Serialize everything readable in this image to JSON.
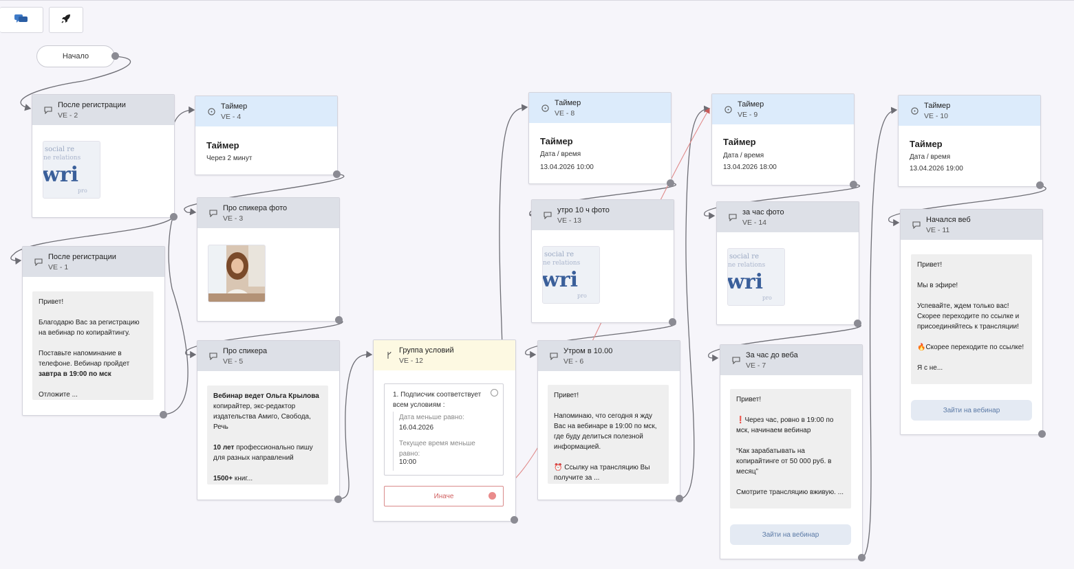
{
  "toolbar": {
    "chat_button_icon": "chat-bubbles-icon",
    "launch_button_icon": "rocket-icon"
  },
  "start_node": {
    "label": "Начало"
  },
  "colors": {
    "message_header": "#dde0e7",
    "timer_header": "#dcebfb",
    "condition_header": "#fdf9e2",
    "connector": "#6d6d74",
    "else_connector": "#e08a8a",
    "button_text": "#5b7aa6"
  },
  "nodes": {
    "ve2": {
      "title": "После регистрации",
      "id": "VE - 2",
      "icon": "chat-bubble-icon",
      "image": "writing-text-thumbnail"
    },
    "ve4": {
      "title": "Таймер",
      "id": "VE - 4",
      "icon": "clock-icon",
      "heading": "Таймер",
      "detail": "Через 2 минут"
    },
    "ve3": {
      "title": "Про спикера фото",
      "id": "VE - 3",
      "icon": "chat-bubble-icon",
      "image": "speaker-photo-thumbnail"
    },
    "ve1": {
      "title": "После регистрации",
      "id": "VE - 1",
      "icon": "chat-bubble-icon",
      "p1": "Привет!",
      "p2": "Благодарю Вас за регистрацию на вебинар по копирайтингу.",
      "p3_text": "Поставьте напоминание в телефоне. Вебинар пройдет",
      "p3_bold": "завтра в 19:00 по мск",
      "p4": "Отложите ..."
    },
    "ve5": {
      "title": "Про спикера",
      "id": "VE - 5",
      "icon": "chat-bubble-icon",
      "p1_bold": "Вебинар ведет Ольга Крылова",
      "p1_text": "копирайтер, экс-редактор издательства Амиго, Свобода, Речь",
      "p2_bold": "10 лет",
      "p2_text": "профессионально пишу для разных направлений",
      "p3_bold": "1500+",
      "p3_text": "книг..."
    },
    "ve12": {
      "title": "Группа условий",
      "id": "VE - 12",
      "icon": "branch-icon",
      "rule_title": "1. Подписчик соответствует всем условиям :",
      "cond1_label": "Дата меньше равно:",
      "cond1_value": "16.04.2026",
      "cond2_label": "Текущее время меньше равно:",
      "cond2_value": "10:00",
      "else_label": "Иначе"
    },
    "ve8": {
      "title": "Таймер",
      "id": "VE - 8",
      "icon": "clock-icon",
      "heading": "Таймер",
      "detail_label": "Дата / время",
      "detail_value": "13.04.2026 10:00"
    },
    "ve13": {
      "title": "утро 10 ч фото",
      "id": "VE - 13",
      "icon": "chat-bubble-icon",
      "image": "writing-text-thumbnail"
    },
    "ve6": {
      "title": "Утром в 10.00",
      "id": "VE - 6",
      "icon": "chat-bubble-icon",
      "p1": "Привет!",
      "p2": "Напоминаю, что сегодня я жду Вас на вебинаре в 19:00 по мск, где буду делиться полезной информацией.",
      "p3": "⏰ Ссылку на трансляцию Вы получите за ..."
    },
    "ve9": {
      "title": "Таймер",
      "id": "VE - 9",
      "icon": "clock-icon",
      "heading": "Таймер",
      "detail_label": "Дата / время",
      "detail_value": "13.04.2026 18:00"
    },
    "ve14": {
      "title": "за час фото",
      "id": "VE - 14",
      "icon": "chat-bubble-icon",
      "image": "writing-text-thumbnail"
    },
    "ve7": {
      "title": "За час до веба",
      "id": "VE - 7",
      "icon": "chat-bubble-icon",
      "p1": "Привет!",
      "p2": "❗Через час, ровно в 19:00 по мск, начинаем вебинар",
      "p3": "“Как зарабатывать на копирайтинге от 50 000 руб. в месяц”",
      "p4": "Смотрите трансляцию вживую. ...",
      "button": "Зайти на вебинар"
    },
    "ve10": {
      "title": "Таймер",
      "id": "VE - 10",
      "icon": "clock-icon",
      "heading": "Таймер",
      "detail_label": "Дата / время",
      "detail_value": "13.04.2026 19:00"
    },
    "ve11": {
      "title": "Начался веб",
      "id": "VE - 11",
      "icon": "chat-bubble-icon",
      "p1": "Привет!",
      "p2": "Мы в эфире!",
      "p3": "Успевайте, ждем только вас! Скорее переходите по ссылке и присоединяйтесь к трансляции!",
      "p4": "🔥Скорее переходите по ссылке!",
      "p5": "Я с не...",
      "button": "Зайти на вебинар"
    }
  }
}
